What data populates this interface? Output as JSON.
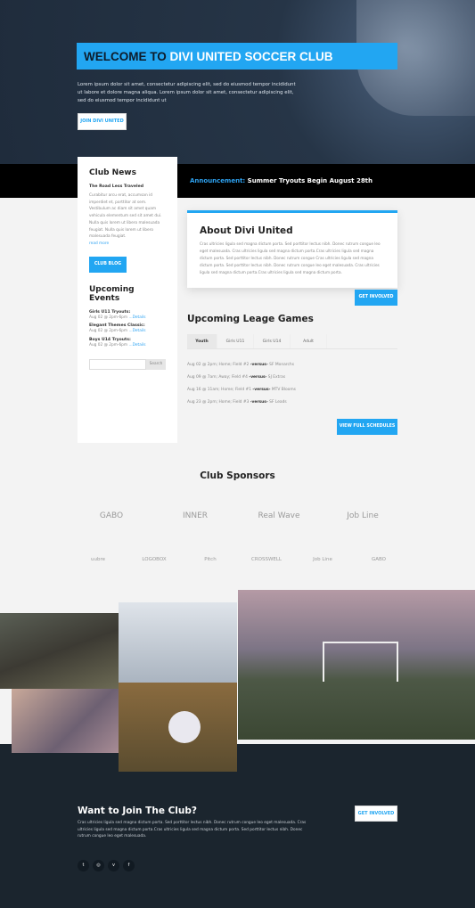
{
  "hero": {
    "title_prefix": "WELCOME TO",
    "title_main": "DIVI UNITED SOCCER CLUB",
    "text": "Lorem ipsum dolor sit amet, consectetur adipiscing elit, sed do eiusmod tempor incididunt ut labore et dolore magna aliqua. Lorem ipsum dolor sit amet, consectetur adipiscing elit, sed do eiusmod tempor incididunt ut",
    "button": "JOIN DIVI UNITED"
  },
  "announcement": {
    "label": "Announcement:",
    "text": "Summer Tryouts Begin August 28th"
  },
  "sidebar": {
    "news_title": "Club News",
    "post_title": "The Road Less Traveled",
    "post_text": "Curabitur arcu erat, accumsan id imperdiet et, porttitor at sem. Vestibulum ac diam sit amet quam vehicula elementum sed sit amet dui. Nulla quis lorem ut libero malesuada feugiat. Nulla quis lorem ut libero malesuada feugiat.",
    "read_more": "read more",
    "blog_button": "CLUB BLOG",
    "events_title": "Upcoming Events",
    "events": [
      {
        "name": "Girls U11 Tryouts:",
        "time": "Aug 02 @ 2pm-6pm",
        "link": "...Details"
      },
      {
        "name": "Elegant Themes Classic:",
        "time": "Aug 02 @ 2pm-6pm",
        "link": "...Details"
      },
      {
        "name": "Boys U14 Tryouts:",
        "time": "Aug 02 @ 2pm-6pm",
        "link": "...Details"
      }
    ],
    "search_placeholder": "",
    "search_button": "Search"
  },
  "about": {
    "title": "About Divi United",
    "text": "Cras ultricies ligula sed magna dictum porta. Sed porttitor lectus nibh. Donec rutrum congue leo eget malesuada. Cras ultricies ligula sed magna dictum porta.Cras ultricies ligula sed magna dictum porta. Sed porttitor lectus nibh. Donec rutrum congue Cras ultricies ligula sed magna dictum porta. Sed porttitor lectus nibh. Donec rutrum congue leo eget malesuada. Cras ultricies ligula sed magna dictum porta.Cras ultricies ligula sed magna dictum porta.",
    "button": "GET INVOLVED"
  },
  "games": {
    "title": "Upcoming Leage Games",
    "tabs": [
      "Youth",
      "Girls U11",
      "Girls U14",
      "Adult"
    ],
    "rows": [
      {
        "info": "Aug 02 @ 2pm; Home; Field #2",
        "vs": "-versus-",
        "team": "SF Monarchs"
      },
      {
        "info": "Aug 09 @ 7am; Away; Field #4",
        "vs": "-versus-",
        "team": "SJ Extras"
      },
      {
        "info": "Aug 16 @ 11am; Home; Field #1",
        "vs": "-versus-",
        "team": "MTV Blooms"
      },
      {
        "info": "Aug 23 @ 2pm; Home; Field #3",
        "vs": "-versus-",
        "team": "SF Leads"
      }
    ],
    "button": "VIEW FULL SCHEDULES"
  },
  "sponsors": {
    "title": "Club Sponsors",
    "row1": [
      "GABO",
      "INNER",
      "Real Wave",
      "Job Line"
    ],
    "row2": [
      "uubre",
      "LOGOBOX",
      "Pitch",
      "CROSSWELL",
      "Job Line",
      "GABO"
    ]
  },
  "footer": {
    "title": "Want to Join The Club?",
    "text": "Cras ultricies ligula sed magna dictum porta. Sed porttitor lectus nibh. Donec rutrum congue leo eget malesuada. Cras ultricies ligula sed magna dictum porta.Cras ultricies ligula sed magna dictum porta. Sed porttitor lectus nibh. Donec rutrum congue leo eget malesuada.",
    "button": "GET INVOLVED",
    "social": [
      {
        "icon": "twitter-icon",
        "glyph": "t"
      },
      {
        "icon": "instagram-icon",
        "glyph": "◎"
      },
      {
        "icon": "vimeo-icon",
        "glyph": "v"
      },
      {
        "icon": "facebook-icon",
        "glyph": "f"
      }
    ]
  },
  "colors": {
    "accent": "#22a6f2",
    "footer_bg": "#1b252e"
  }
}
